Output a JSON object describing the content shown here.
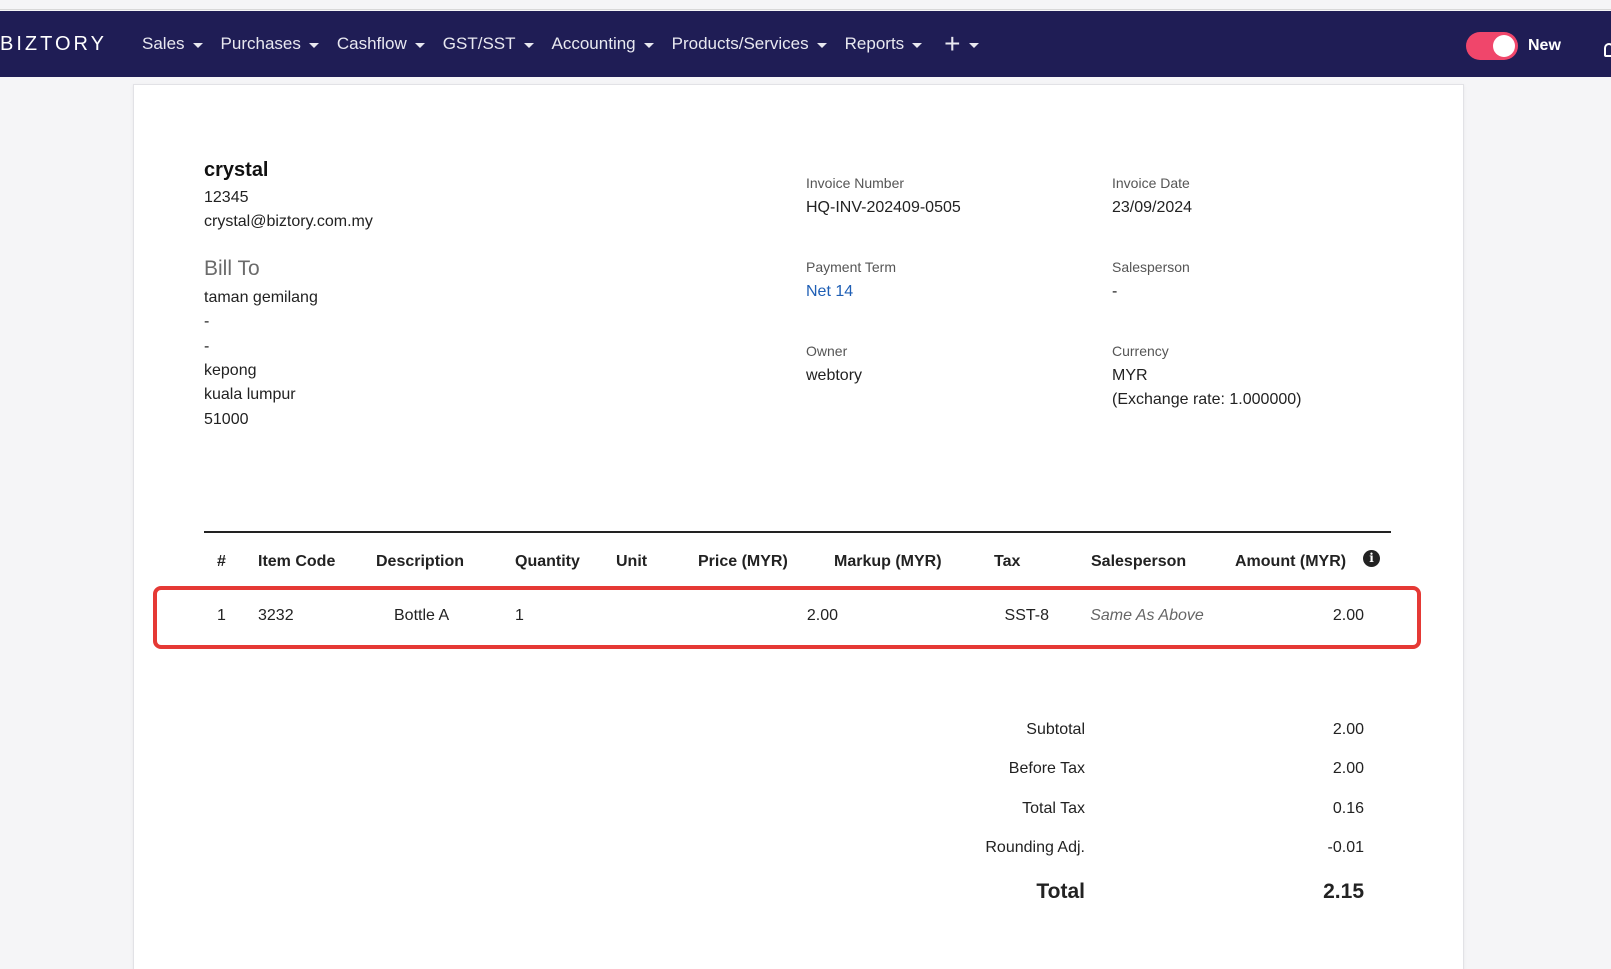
{
  "nav": {
    "logo": "BIZTORY",
    "items": [
      {
        "label": "Sales"
      },
      {
        "label": "Purchases"
      },
      {
        "label": "Cashflow"
      },
      {
        "label": "GST/SST"
      },
      {
        "label": "Accounting"
      },
      {
        "label": "Products/Services"
      },
      {
        "label": "Reports"
      }
    ],
    "plus_icon": "plus-icon",
    "toggle_label": "New",
    "toggle_on": true,
    "toggle_color": "#f0466b",
    "bg_color": "#1f1d55"
  },
  "invoice": {
    "company": {
      "name": "crystal",
      "phone": "12345",
      "email": "crystal@biztory.com.my"
    },
    "bill_to": {
      "heading": "Bill To",
      "lines": [
        "taman gemilang",
        "-",
        "-",
        "kepong",
        "kuala lumpur",
        "51000"
      ]
    },
    "meta": {
      "invoice_number_label": "Invoice Number",
      "invoice_number": "HQ-INV-202409-0505",
      "invoice_date_label": "Invoice Date",
      "invoice_date": "23/09/2024",
      "payment_term_label": "Payment Term",
      "payment_term": "Net 14",
      "salesperson_label": "Salesperson",
      "salesperson": "-",
      "owner_label": "Owner",
      "owner": "webtory",
      "currency_label": "Currency",
      "currency": "MYR",
      "exchange_rate": "(Exchange rate: 1.000000)"
    },
    "table": {
      "headers": [
        "#",
        "Item Code",
        "Description",
        "Quantity",
        "Unit",
        "Price (MYR)",
        "Markup (MYR)",
        "Tax",
        "Salesperson",
        "Amount (MYR)"
      ],
      "rows": [
        {
          "no": "1",
          "item_code": "3232",
          "description": "Bottle A",
          "quantity": "1",
          "unit": "",
          "price": "2.00",
          "markup": "",
          "tax": "SST-8",
          "salesperson": "Same As Above",
          "amount": "2.00"
        }
      ],
      "highlight_color": "#e53935"
    },
    "totals": {
      "subtotal_label": "Subtotal",
      "subtotal": "2.00",
      "before_tax_label": "Before Tax",
      "before_tax": "2.00",
      "total_tax_label": "Total Tax",
      "total_tax": "0.16",
      "rounding_label": "Rounding Adj.",
      "rounding": "-0.01",
      "total_label": "Total",
      "total": "2.15"
    }
  }
}
